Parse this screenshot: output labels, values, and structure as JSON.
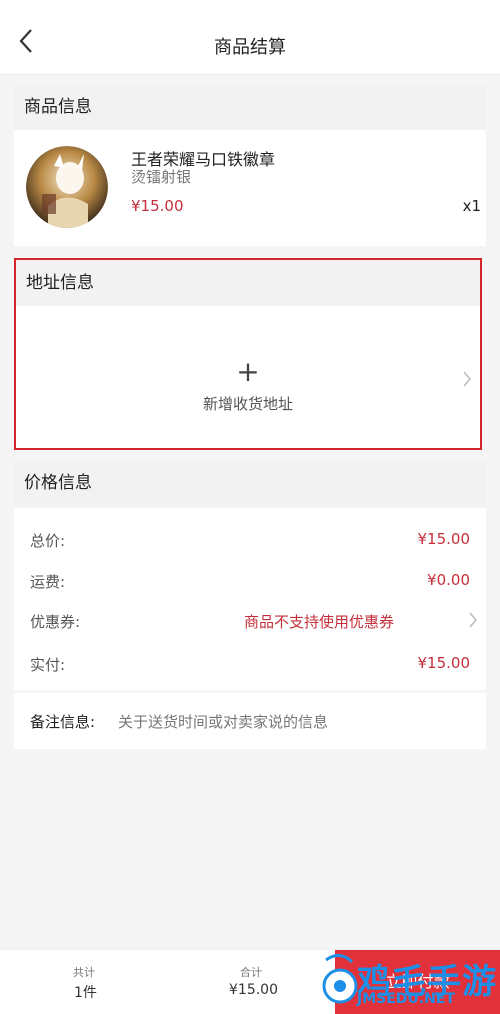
{
  "header": {
    "title": "商品结算",
    "back_icon": "back-arrow-icon"
  },
  "product": {
    "section_title": "商品信息",
    "name": "王者荣耀马口铁徽章",
    "variant": "烫镭射银",
    "price": "¥15.00",
    "quantity": "x1"
  },
  "address": {
    "section_title": "地址信息",
    "add_symbol": "+",
    "add_label": "新增收货地址"
  },
  "price_info": {
    "section_title": "价格信息",
    "rows": [
      {
        "label": "总价:",
        "value": "¥15.00"
      },
      {
        "label": "运费:",
        "value": "¥0.00"
      },
      {
        "label": "优惠券:",
        "value": "商品不支持使用优惠券"
      },
      {
        "label": "实付:",
        "value": "¥15.00"
      }
    ],
    "remark_label": "备注信息:",
    "remark_placeholder": "关于送货时间或对卖家说的信息"
  },
  "bottom": {
    "count_label": "共计",
    "count_value": "1件",
    "total_label": "合计",
    "total_value": "¥15.00",
    "pay_button": "立即付款"
  },
  "watermark": {
    "text": "鸡毛手游",
    "url": "JMSEDU.NET"
  },
  "colors": {
    "accent_red": "#c52f3a",
    "highlight_border": "#d7262b",
    "pay_button": "#e1313a",
    "watermark_blue": "#1e8fe7"
  }
}
